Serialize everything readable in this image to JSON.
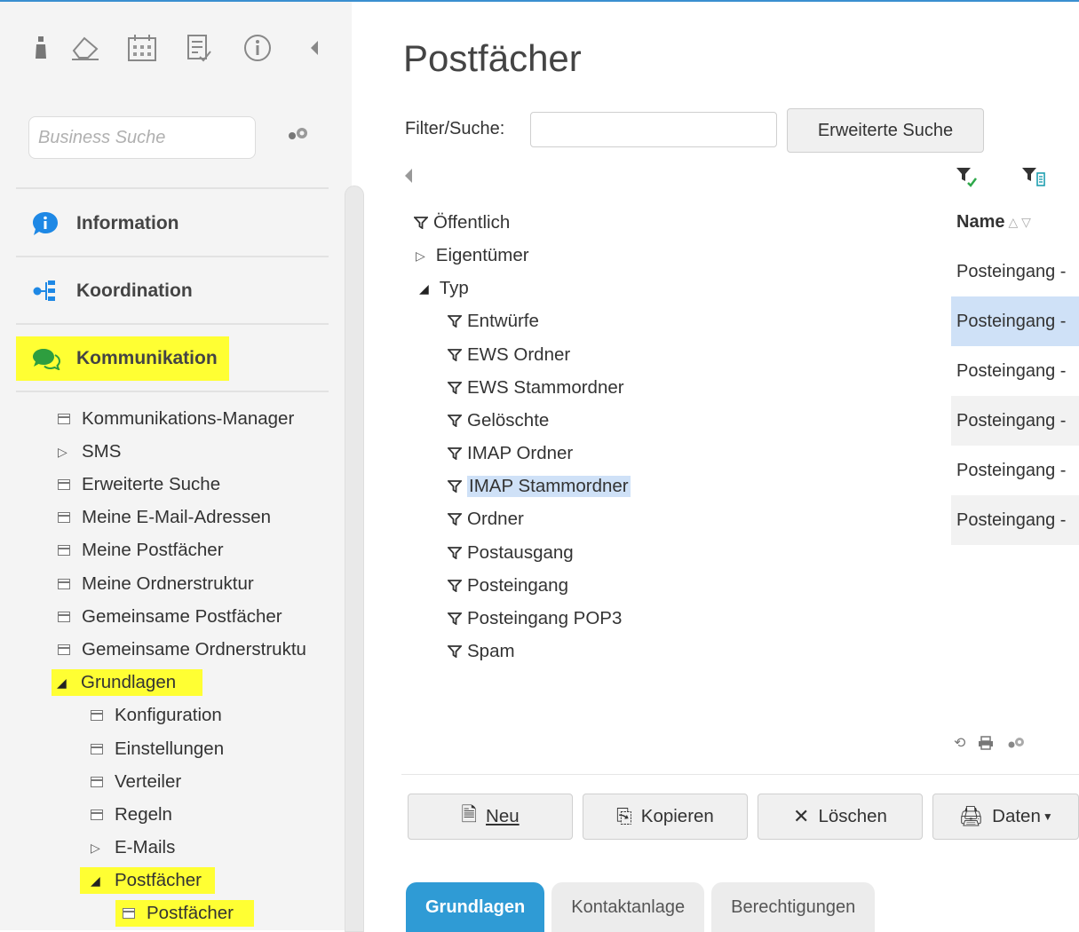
{
  "sidebar": {
    "toolbar_icons": [
      "bottle-icon",
      "eraser-icon",
      "calendar-icon",
      "task-list-icon",
      "info-circle-icon",
      "collapse-left-icon"
    ],
    "search_placeholder": "Business Suche",
    "sections": [
      {
        "label": "Information",
        "icon": "info-bubble-icon",
        "color": "#1e88e5"
      },
      {
        "label": "Koordination",
        "icon": "org-chart-icon",
        "color": "#1e88e5"
      },
      {
        "label": "Kommunikation",
        "icon": "chat-bubbles-icon",
        "color": "#2e9e3f"
      }
    ],
    "tree": [
      {
        "label": "Kommunikations-Manager"
      },
      {
        "label": "SMS"
      },
      {
        "label": "Erweiterte Suche"
      },
      {
        "label": "Meine E-Mail-Adressen"
      },
      {
        "label": "Meine Postfächer"
      },
      {
        "label": "Meine Ordnerstruktur"
      },
      {
        "label": "Gemeinsame Postfächer"
      },
      {
        "label": "Gemeinsame Ordnerstruktu"
      },
      {
        "label": "Grundlagen"
      },
      {
        "label": "Konfiguration"
      },
      {
        "label": "Einstellungen"
      },
      {
        "label": "Verteiler"
      },
      {
        "label": "Regeln"
      },
      {
        "label": "E-Mails"
      },
      {
        "label": "Postfächer"
      },
      {
        "label": "Postfächer"
      }
    ]
  },
  "main": {
    "title": "Postfächer",
    "filter_label": "Filter/Suche:",
    "filter_value": "",
    "advanced_search_label": "Erweiterte Suche",
    "filter_tree": [
      {
        "label": "Öffentlich"
      },
      {
        "label": "Eigentümer"
      },
      {
        "label": "Typ"
      },
      {
        "label": "Entwürfe"
      },
      {
        "label": "EWS Ordner"
      },
      {
        "label": "EWS Stammordner"
      },
      {
        "label": "Gelöschte"
      },
      {
        "label": "IMAP Ordner"
      },
      {
        "label": "IMAP Stammordner"
      },
      {
        "label": "Ordner"
      },
      {
        "label": "Postausgang"
      },
      {
        "label": "Posteingang"
      },
      {
        "label": "Posteingang POP3"
      },
      {
        "label": "Spam"
      }
    ],
    "grid": {
      "column_name": "Name",
      "rows": [
        "Posteingang -",
        "Posteingang -",
        "Posteingang -",
        "Posteingang -",
        "Posteingang -",
        "Posteingang -"
      ]
    },
    "actions": {
      "new": "Neu",
      "copy": "Kopieren",
      "delete": "Löschen",
      "data": "Daten"
    },
    "tabs": [
      "Grundlagen",
      "Kontaktanlage",
      "Berechtigungen"
    ]
  },
  "colors": {
    "highlight": "#ffff33",
    "selection": "#cfe1f7",
    "active_tab": "#2f9bd5",
    "accent_line": "#3a8fd0"
  }
}
